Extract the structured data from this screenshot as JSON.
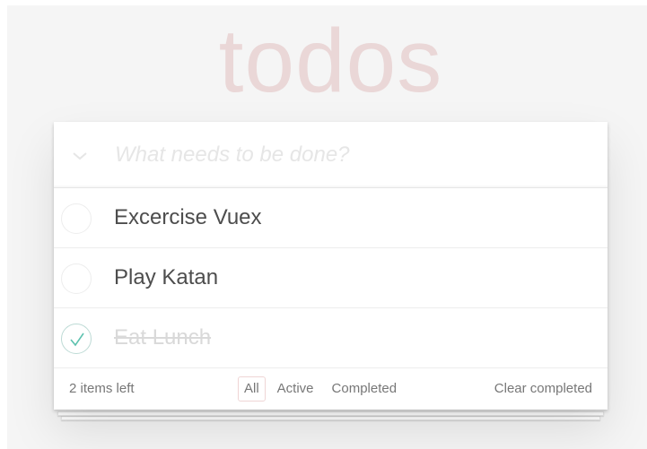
{
  "app": {
    "title": "todos",
    "accent_color": "#af2f2f"
  },
  "header": {
    "toggle_icon": "chevron-down-icon",
    "placeholder": "What needs to be done?",
    "value": ""
  },
  "todos": [
    {
      "label": "Excercise Vuex",
      "completed": false
    },
    {
      "label": "Play Katan",
      "completed": false
    },
    {
      "label": "Eat Lunch",
      "completed": true
    }
  ],
  "footer": {
    "count_text": "2 items left",
    "filters": [
      {
        "label": "All",
        "selected": true
      },
      {
        "label": "Active",
        "selected": false
      },
      {
        "label": "Completed",
        "selected": false
      }
    ],
    "clear_label": "Clear completed"
  }
}
